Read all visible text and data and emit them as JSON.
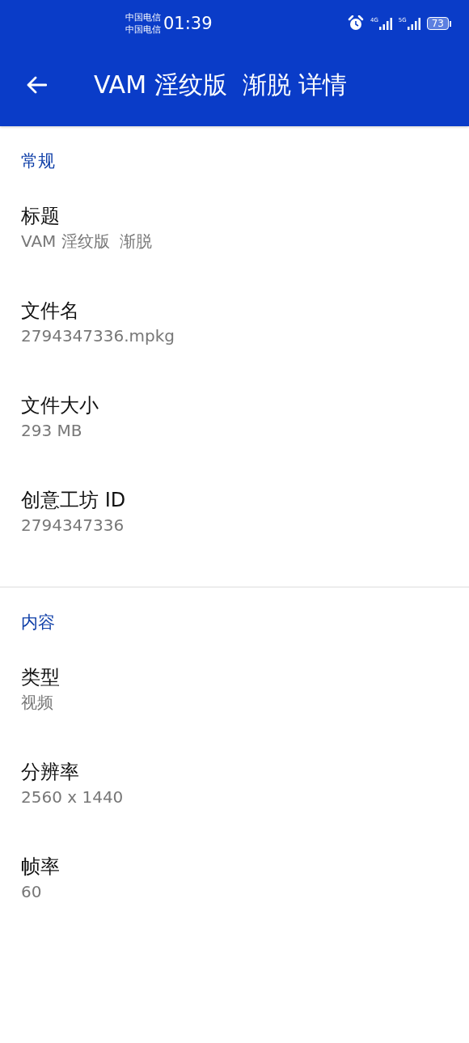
{
  "status_bar": {
    "carriers": [
      "中国电信",
      "中国电信"
    ],
    "time": "01:39",
    "signals": [
      {
        "network": "4G"
      },
      {
        "network": "5G"
      }
    ],
    "battery": "73"
  },
  "app_bar": {
    "title": "VAM 淫纹版  渐脱 详情"
  },
  "sections": [
    {
      "header": "常规",
      "items": [
        {
          "label": "标题",
          "value": "VAM 淫纹版  渐脱"
        },
        {
          "label": "文件名",
          "value": "2794347336.mpkg"
        },
        {
          "label": "文件大小",
          "value": "293 MB"
        },
        {
          "label": "创意工坊 ID",
          "value": "2794347336"
        }
      ]
    },
    {
      "header": "内容",
      "items": [
        {
          "label": "类型",
          "value": "视频"
        },
        {
          "label": "分辨率",
          "value": "2560 x 1440"
        },
        {
          "label": "帧率",
          "value": "60"
        }
      ]
    }
  ]
}
